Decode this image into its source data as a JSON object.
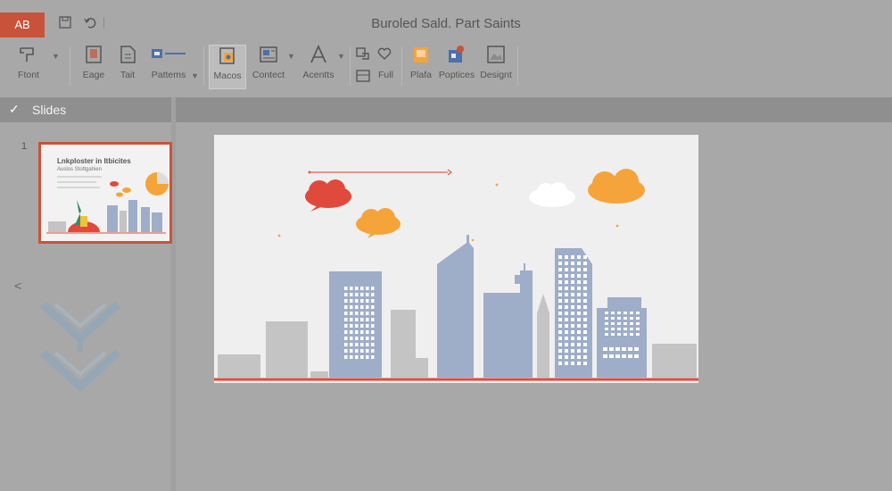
{
  "app": {
    "badge": "AB"
  },
  "title": "Buroled Sald. Part Saints",
  "ribbon": {
    "buttons": [
      {
        "id": "font",
        "label": "Ftont",
        "icon": "brush-icon"
      },
      {
        "id": "image",
        "label": "Eage",
        "icon": "image-icon"
      },
      {
        "id": "tail",
        "label": "Tait",
        "icon": "document-icon"
      },
      {
        "id": "patterns",
        "label": "Pattems",
        "icon": "pattern-icon"
      },
      {
        "id": "macros",
        "label": "Macos",
        "icon": "macro-icon"
      },
      {
        "id": "content",
        "label": "Contect",
        "icon": "content-icon"
      },
      {
        "id": "accents",
        "label": "Acentts",
        "icon": "accent-icon"
      },
      {
        "id": "full",
        "label": "Full",
        "icon": "shapes-icon"
      },
      {
        "id": "plan",
        "label": "Plafa",
        "icon": "plan-icon"
      },
      {
        "id": "poptices",
        "label": "Poptices",
        "icon": "puzzle-icon"
      },
      {
        "id": "design",
        "label": "Designt",
        "icon": "design-icon"
      }
    ]
  },
  "slides_pane": {
    "header": "Slides",
    "slide_number": "1",
    "thumbnail_title": "Lnkploster in Itbicites",
    "thumbnail_subtitle": "Auslos Stottgahien"
  },
  "colors": {
    "accent": "#c9533a",
    "building": "#9eadc8",
    "gray_building": "#c4c4c4",
    "cloud_red": "#e04a3c",
    "cloud_orange": "#f5a43a",
    "cloud_white": "#ffffff"
  }
}
